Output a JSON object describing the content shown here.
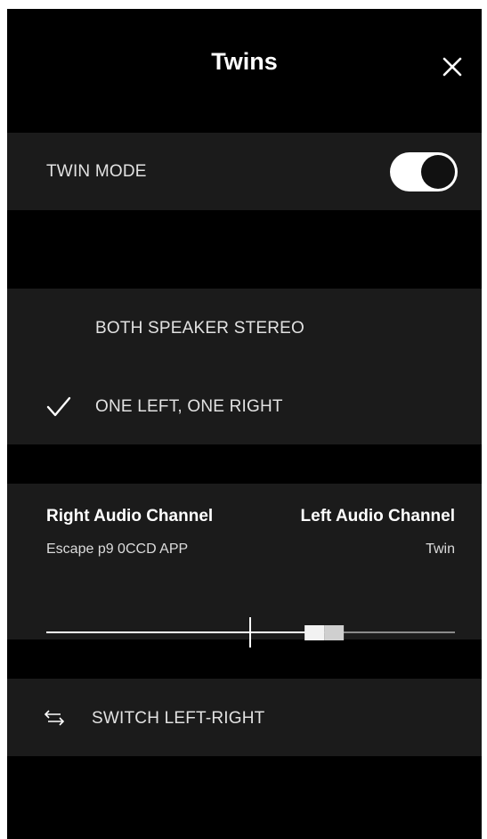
{
  "header": {
    "title": "Twins",
    "close_icon": "close-icon"
  },
  "twin_mode": {
    "label": "TWIN MODE",
    "enabled": true
  },
  "stereo_mode": {
    "options": [
      {
        "label": "BOTH SPEAKER STEREO",
        "selected": false
      },
      {
        "label": "ONE LEFT, ONE RIGHT",
        "selected": true
      }
    ]
  },
  "channels": {
    "right": {
      "title": "Right Audio Channel",
      "device": "Escape p9 0CCD APP"
    },
    "left": {
      "title": "Left Audio Channel",
      "device": "Twin"
    },
    "balance_position": 0.68
  },
  "switch": {
    "label": "SWITCH LEFT-RIGHT",
    "icon": "swap-arrows-icon"
  },
  "colors": {
    "background": "#000000",
    "panel": "#1b1b1b",
    "text": "#ffffff",
    "toggle_on": "#ffffff"
  }
}
